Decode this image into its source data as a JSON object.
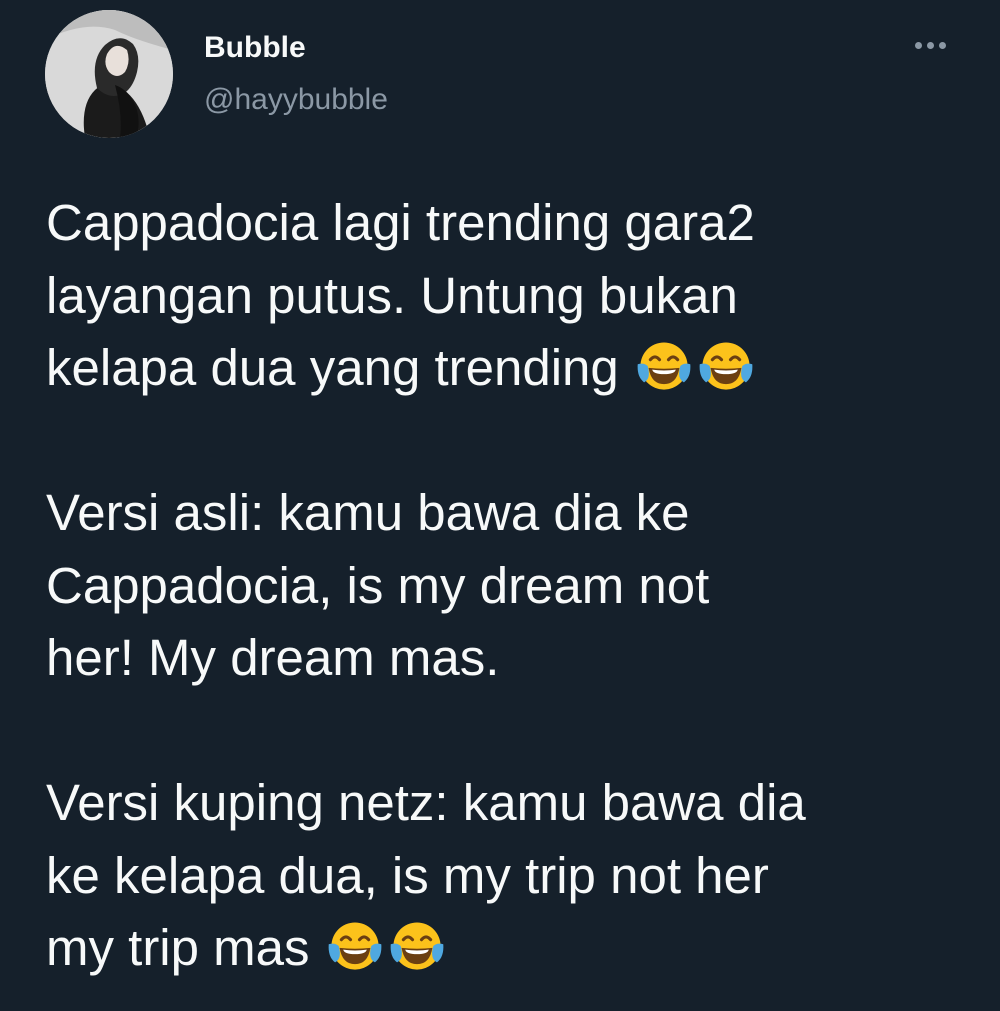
{
  "tweet": {
    "author": {
      "display_name": "Bubble",
      "handle": "@hayybubble",
      "avatar_icon": "profile-photo"
    },
    "more_icon": "more-options-icon",
    "paragraphs": [
      {
        "text": "Cappadocia lagi trending gara2\nlayangan putus. Untung bukan\nkelapa dua yang trending",
        "trailing_emoji": [
          "face-with-tears-of-joy",
          "face-with-tears-of-joy"
        ]
      },
      {
        "text": "Versi asli: kamu bawa dia ke\nCappadocia, is my dream not\nher! My dream mas.",
        "trailing_emoji": []
      },
      {
        "text": "Versi kuping netz: kamu bawa dia\nke kelapa dua, is my trip not her\nmy trip mas",
        "trailing_emoji": [
          "face-with-tears-of-joy",
          "face-with-tears-of-joy"
        ]
      }
    ],
    "colors": {
      "background": "#15202b",
      "text": "#f7f9f9",
      "secondary_text": "#8b98a5",
      "emoji_face": "#fcc21b",
      "emoji_tears": "#4fa8e0"
    }
  }
}
